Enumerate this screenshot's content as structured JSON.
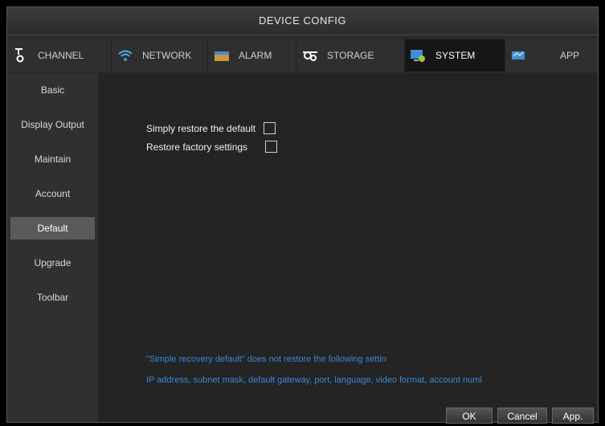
{
  "window": {
    "title": "DEVICE CONFIG"
  },
  "tabs": [
    {
      "label": "CHANNEL",
      "icon": "channel-icon"
    },
    {
      "label": "NETWORK",
      "icon": "wifi-icon"
    },
    {
      "label": "ALARM",
      "icon": "alarm-icon"
    },
    {
      "label": "STORAGE",
      "icon": "storage-icon"
    },
    {
      "label": "SYSTEM",
      "icon": "system-icon",
      "active": true
    },
    {
      "label": "APP",
      "icon": "app-icon"
    }
  ],
  "sidebar": {
    "items": [
      {
        "label": "Basic"
      },
      {
        "label": "Display Output"
      },
      {
        "label": "Maintain"
      },
      {
        "label": "Account"
      },
      {
        "label": "Default",
        "active": true
      },
      {
        "label": "Upgrade"
      },
      {
        "label": "Toolbar"
      }
    ]
  },
  "main": {
    "options": [
      {
        "label": "Simply restore the default",
        "checked": false
      },
      {
        "label": "Restore factory settings",
        "checked": false
      }
    ],
    "notes": [
      "\"Simple recovery default\" does not restore the following settin",
      "IP address, subnet mask, default gateway, port, language, video format, account numl"
    ]
  },
  "buttons": {
    "ok": "OK",
    "cancel": "Cancel",
    "apply": "App."
  },
  "colors": {
    "note": "#3a86d6",
    "active_tab": "#161616",
    "active_sidebar": "#5a5a5a"
  }
}
